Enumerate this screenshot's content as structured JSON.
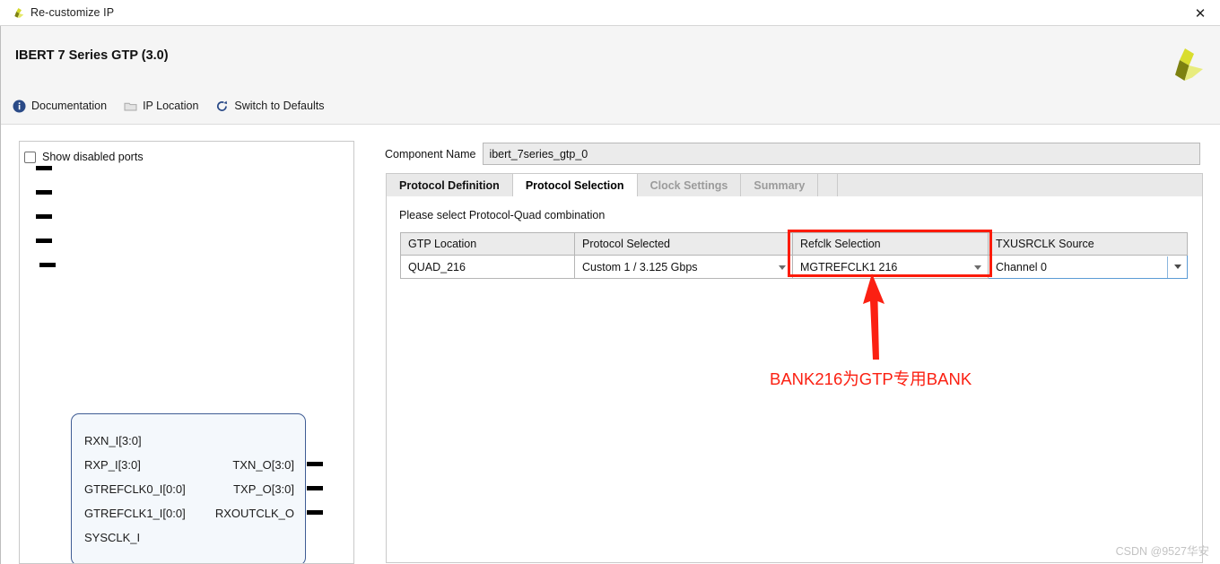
{
  "window": {
    "title": "Re-customize IP",
    "icon": "xilinx-logo-icon",
    "close_label": "✕"
  },
  "header": {
    "ip_title": "IBERT 7 Series GTP (3.0)",
    "logo": "xilinx-pinwheel-logo",
    "toolbar": [
      {
        "label": "Documentation",
        "icon": "info-icon"
      },
      {
        "label": "IP Location",
        "icon": "folder-icon"
      },
      {
        "label": "Switch to Defaults",
        "icon": "refresh-icon"
      }
    ]
  },
  "left_panel": {
    "show_disabled_ports": {
      "label": "Show disabled ports",
      "checked": false
    },
    "block_diagram": {
      "left_ports": [
        "RXN_I[3:0]",
        "RXP_I[3:0]",
        "GTREFCLK0_I[0:0]",
        "GTREFCLK1_I[0:0]",
        "SYSCLK_I"
      ],
      "right_ports": [
        "TXN_O[3:0]",
        "TXP_O[3:0]",
        "RXOUTCLK_O"
      ],
      "border_color": "#3f5c94",
      "fill_color": "#f4f8fc"
    }
  },
  "main": {
    "component_name": {
      "label": "Component Name",
      "value": "ibert_7series_gtp_0"
    },
    "tabs": [
      {
        "label": "Protocol Definition",
        "state": "normal"
      },
      {
        "label": "Protocol Selection",
        "state": "active"
      },
      {
        "label": "Clock Settings",
        "state": "disabled"
      },
      {
        "label": "Summary",
        "state": "disabled"
      }
    ],
    "hint": "Please select Protocol-Quad combination",
    "table": {
      "columns": [
        "GTP Location",
        "Protocol Selected",
        "Refclk Selection",
        "TXUSRCLK Source"
      ],
      "rows": [
        {
          "gtp_location": "QUAD_216",
          "protocol_selected": "Custom 1 / 3.125 Gbps",
          "refclk_selection": "MGTREFCLK1 216",
          "txusrclk_source": "Channel 0"
        }
      ]
    }
  },
  "annotation": {
    "note_text": "BANK216为GTP专用BANK",
    "color": "#fb2012",
    "highlight_target": "refclk-selection-column"
  },
  "watermark": {
    "text": "CSDN @9527华安"
  }
}
